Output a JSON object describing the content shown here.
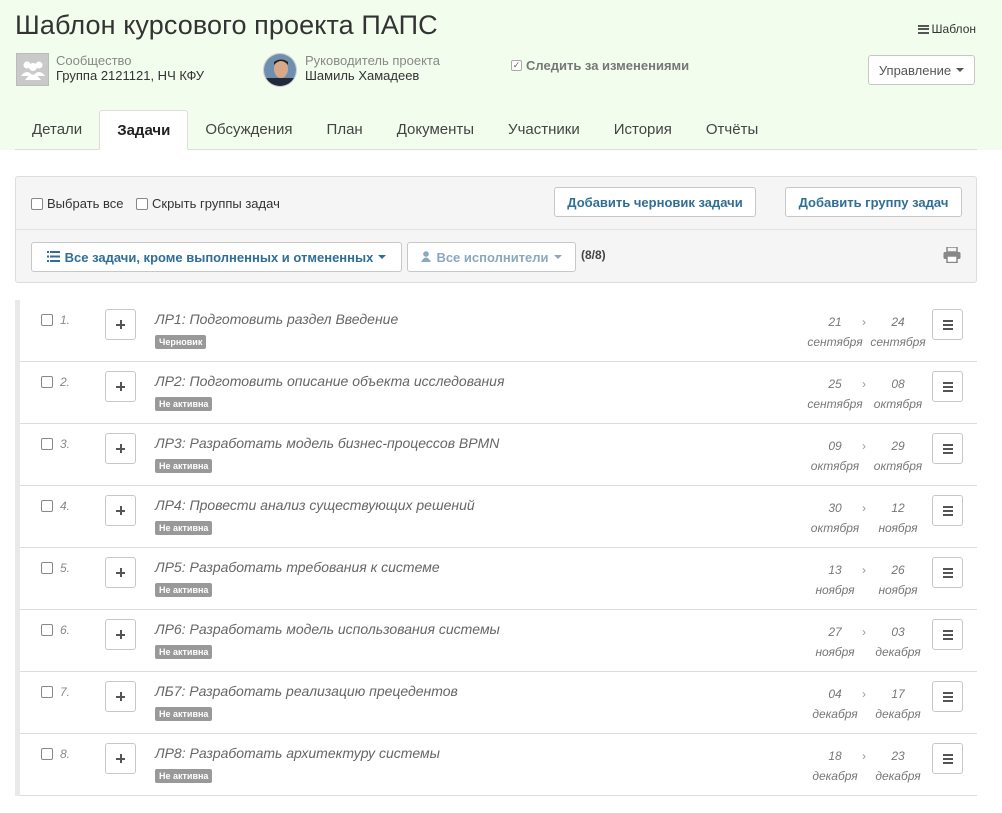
{
  "project": {
    "title": "Шаблон курсового проекта ПАПС",
    "template_label": "Шаблон",
    "community_label": "Сообщество",
    "community_value": "Группа 2121121, НЧ КФУ",
    "leader_label": "Руководитель проекта",
    "leader_value": "Шамиль Хамадеев",
    "follow_label": "Следить за изменениями",
    "manage_label": "Управление"
  },
  "tabs": [
    "Детали",
    "Задачи",
    "Обсуждения",
    "План",
    "Документы",
    "Участники",
    "История",
    "Отчёты"
  ],
  "active_tab": "Задачи",
  "toolbar": {
    "select_all": "Выбрать все",
    "hide_groups": "Скрыть группы задач",
    "add_draft": "Добавить черновик задачи",
    "add_group": "Добавить группу задач",
    "filter_tasks": "Все задачи, кроме выполненных и отмененных",
    "filter_users": "Все исполнители",
    "count": "(8/8)"
  },
  "tasks": [
    {
      "num": "1.",
      "title": "ЛР1: Подготовить раздел Введение",
      "status": "Черновик",
      "start_day": "21",
      "start_month": "сентября",
      "end_day": "24",
      "end_month": "сентября"
    },
    {
      "num": "2.",
      "title": "ЛР2: Подготовить описание объекта исследования",
      "status": "Не активна",
      "start_day": "25",
      "start_month": "сентября",
      "end_day": "08",
      "end_month": "октября"
    },
    {
      "num": "3.",
      "title": "ЛР3: Разработать модель бизнес-процессов BPMN",
      "status": "Не активна",
      "start_day": "09",
      "start_month": "октября",
      "end_day": "29",
      "end_month": "октября"
    },
    {
      "num": "4.",
      "title": "ЛР4: Провести анализ существующих решений",
      "status": "Не активна",
      "start_day": "30",
      "start_month": "октября",
      "end_day": "12",
      "end_month": "ноября"
    },
    {
      "num": "5.",
      "title": "ЛР5: Разработать требования к системе",
      "status": "Не активна",
      "start_day": "13",
      "start_month": "ноября",
      "end_day": "26",
      "end_month": "ноября"
    },
    {
      "num": "6.",
      "title": "ЛР6: Разработать модель использования системы",
      "status": "Не активна",
      "start_day": "27",
      "start_month": "ноября",
      "end_day": "03",
      "end_month": "декабря"
    },
    {
      "num": "7.",
      "title": "ЛБ7: Разработать реализацию прецедентов",
      "status": "Не активна",
      "start_day": "04",
      "start_month": "декабря",
      "end_day": "17",
      "end_month": "декабря"
    },
    {
      "num": "8.",
      "title": "ЛР8: Разработать архитектуру системы",
      "status": "Не активна",
      "start_day": "18",
      "start_month": "декабря",
      "end_day": "23",
      "end_month": "декабря"
    }
  ],
  "arrow_glyph": "›",
  "icons": {
    "template": "list-icon",
    "community": "users-icon",
    "filter_tasks": "list-icon",
    "filter_users": "user-icon",
    "print": "printer-icon",
    "add": "plus-icon",
    "row_menu": "hamburger-icon"
  },
  "colors": {
    "header_bg": "#f3fdee",
    "link_blue": "#2f6e97",
    "badge_gray": "#999999"
  }
}
